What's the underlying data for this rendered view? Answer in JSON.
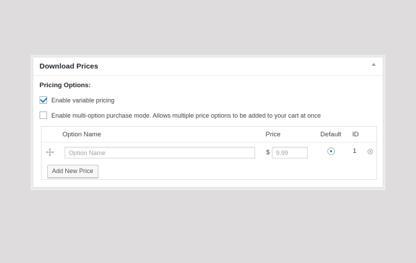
{
  "metabox": {
    "title": "Download Prices"
  },
  "pricing_options": {
    "label": "Pricing Options:",
    "variable_pricing": {
      "label": "Enable variable pricing",
      "checked": true
    },
    "multi_option": {
      "label": "Enable multi-option purchase mode. Allows multiple price options to be added to your cart at once",
      "checked": false
    }
  },
  "table": {
    "headers": {
      "name": "Option Name",
      "price": "Price",
      "default": "Default",
      "id": "ID"
    },
    "rows": [
      {
        "name_placeholder": "Option Name",
        "currency": "$",
        "price_placeholder": "9.99",
        "default_selected": true,
        "id": "1"
      }
    ]
  },
  "add_button": {
    "label": "Add New Price"
  },
  "icons": {
    "toggle": "collapse-arrow-icon",
    "drag": "move-icon",
    "remove": "remove-icon"
  },
  "colors": {
    "accent": "#1e8cbe",
    "background": "#dedcdc"
  }
}
